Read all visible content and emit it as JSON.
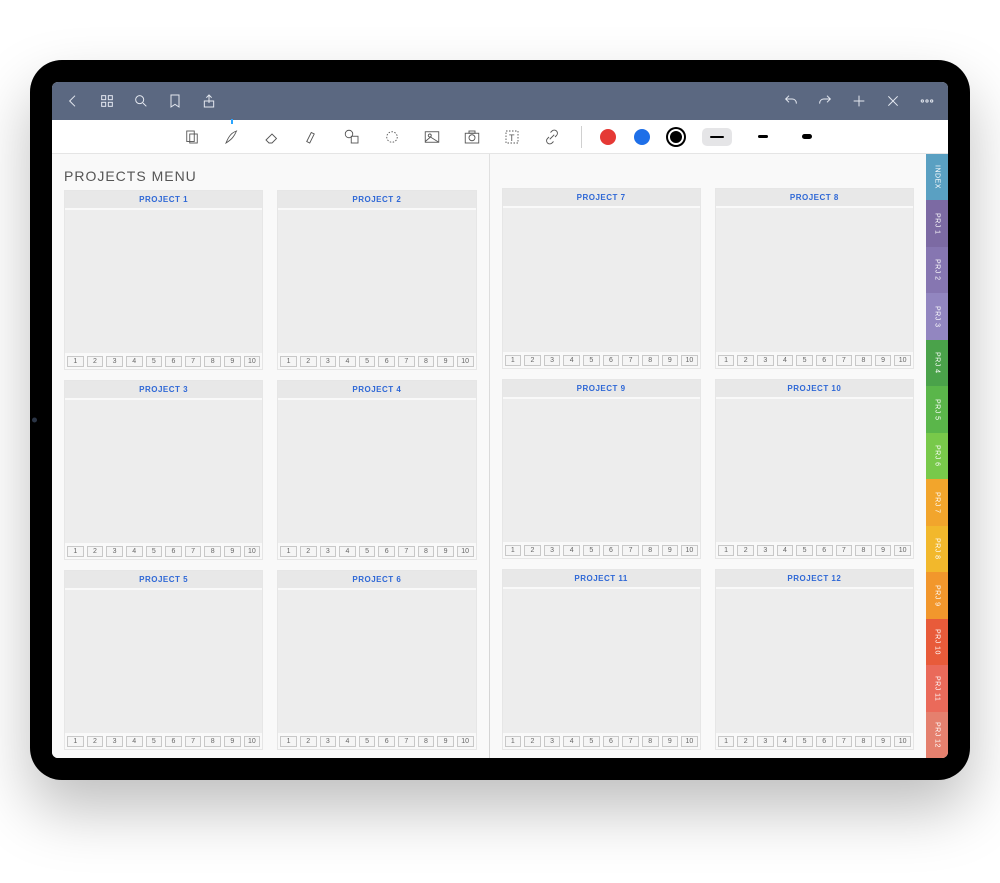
{
  "page_title": "PROJECTS MENU",
  "projects_left": [
    {
      "label": "PROJECT 1"
    },
    {
      "label": "PROJECT 2"
    },
    {
      "label": "PROJECT 3"
    },
    {
      "label": "PROJECT 4"
    },
    {
      "label": "PROJECT 5"
    },
    {
      "label": "PROJECT 6"
    }
  ],
  "projects_right": [
    {
      "label": "PROJECT 7"
    },
    {
      "label": "PROJECT 8"
    },
    {
      "label": "PROJECT 9"
    },
    {
      "label": "PROJECT 10"
    },
    {
      "label": "PROJECT 11"
    },
    {
      "label": "PROJECT 12"
    }
  ],
  "page_numbers": [
    "1",
    "2",
    "3",
    "4",
    "5",
    "6",
    "7",
    "8",
    "9",
    "10"
  ],
  "side_tabs": [
    {
      "label": "INDEX",
      "color": "#5aa0c2"
    },
    {
      "label": "PRJ 1",
      "color": "#7c6aa3"
    },
    {
      "label": "PRJ 2",
      "color": "#8676b1"
    },
    {
      "label": "PRJ 3",
      "color": "#9286c0"
    },
    {
      "label": "PRJ 4",
      "color": "#4aa24a"
    },
    {
      "label": "PRJ 5",
      "color": "#5ab64a"
    },
    {
      "label": "PRJ 6",
      "color": "#78c94a"
    },
    {
      "label": "PRJ 7",
      "color": "#f2a52c"
    },
    {
      "label": "PRJ 8",
      "color": "#f2b82c"
    },
    {
      "label": "PRJ 9",
      "color": "#f2972c"
    },
    {
      "label": "PRJ 10",
      "color": "#e85b3a"
    },
    {
      "label": "PRJ 11",
      "color": "#ea6a5a"
    },
    {
      "label": "PRJ 12",
      "color": "#e5806e"
    }
  ],
  "colors": {
    "red": "#e53935",
    "blue": "#1e6fe8",
    "black": "#000000"
  },
  "stroke_widths": [
    {
      "w": 14,
      "h": 2
    },
    {
      "w": 10,
      "h": 3
    },
    {
      "w": 10,
      "h": 5
    }
  ]
}
